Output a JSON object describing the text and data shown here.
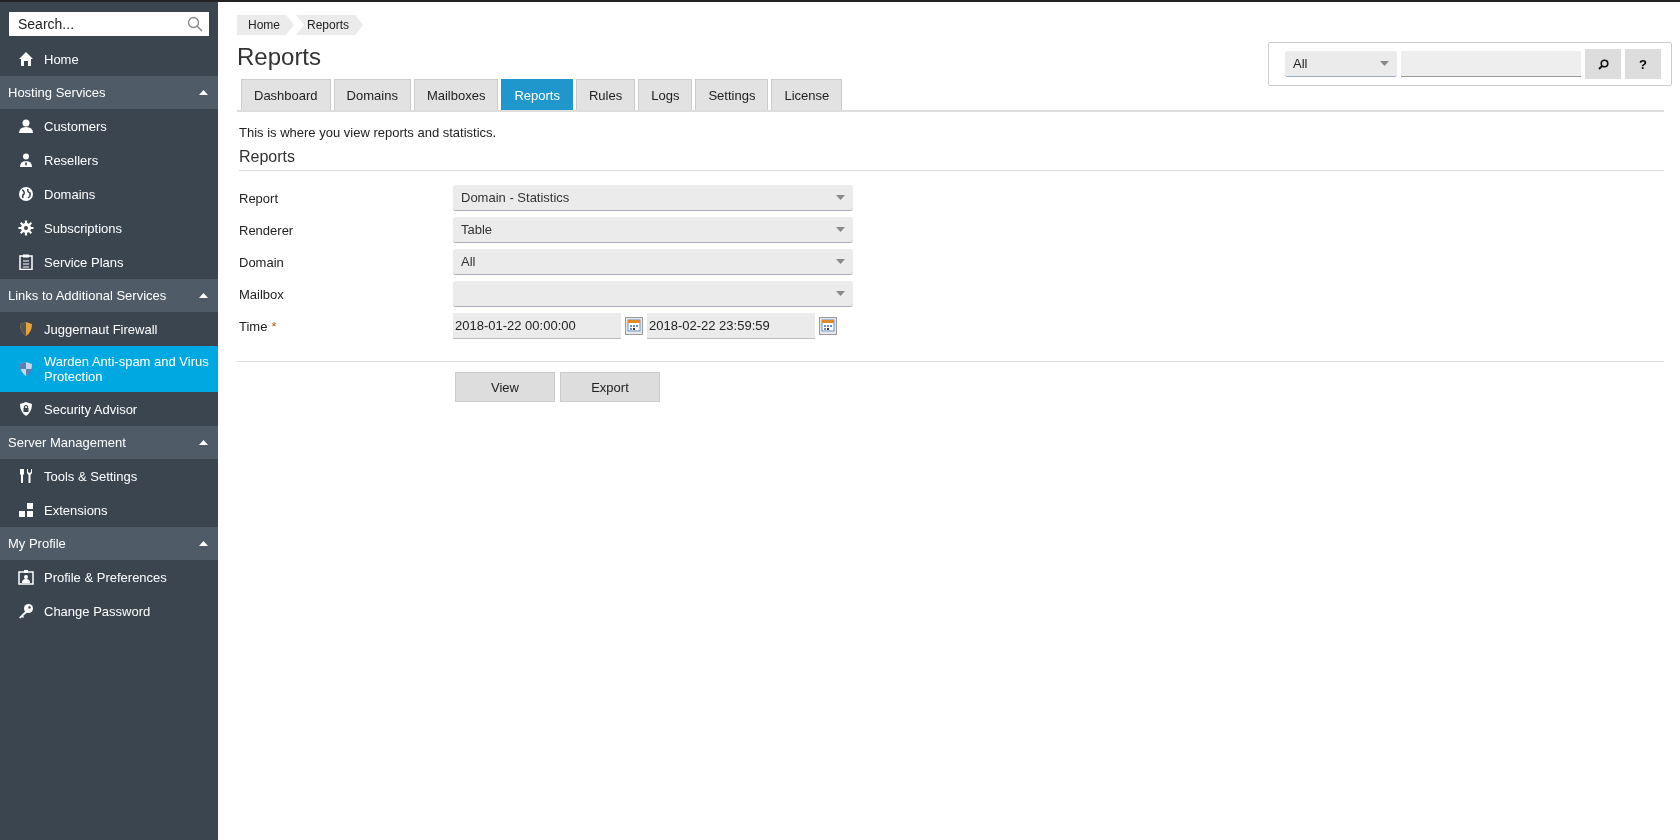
{
  "sidebar": {
    "search": {
      "placeholder": "Search..."
    },
    "top_items": [
      {
        "label": "Home",
        "kind": "home",
        "selected": false
      }
    ],
    "sections": [
      {
        "title": "Hosting Services",
        "expanded": true,
        "items": [
          {
            "label": "Customers",
            "kind": "person",
            "selected": false
          },
          {
            "label": "Resellers",
            "kind": "reseller",
            "selected": false
          },
          {
            "label": "Domains",
            "kind": "globe",
            "selected": false
          },
          {
            "label": "Subscriptions",
            "kind": "gear",
            "selected": false
          },
          {
            "label": "Service Plans",
            "kind": "clipboard",
            "selected": false
          }
        ]
      },
      {
        "title": "Links to Additional Services",
        "expanded": true,
        "items": [
          {
            "label": "Juggernaut Firewall",
            "kind": "shield-orange",
            "selected": false
          },
          {
            "label": "Warden Anti-spam and Virus Protection",
            "kind": "shield-blue",
            "selected": true
          },
          {
            "label": "Security Advisor",
            "kind": "shield-lock",
            "selected": false
          }
        ]
      },
      {
        "title": "Server Management",
        "expanded": true,
        "items": [
          {
            "label": "Tools & Settings",
            "kind": "tools",
            "selected": false
          },
          {
            "label": "Extensions",
            "kind": "blocks",
            "selected": false
          }
        ]
      },
      {
        "title": "My Profile",
        "expanded": true,
        "items": [
          {
            "label": "Profile & Preferences",
            "kind": "profile",
            "selected": false
          },
          {
            "label": "Change Password",
            "kind": "key",
            "selected": false
          }
        ]
      }
    ]
  },
  "breadcrumbs": [
    "Home",
    "Reports"
  ],
  "title": "Reports",
  "global_search": {
    "filter": "All",
    "help_button": "?"
  },
  "tabs": [
    {
      "label": "Dashboard",
      "selected": false
    },
    {
      "label": "Domains",
      "selected": false
    },
    {
      "label": "Mailboxes",
      "selected": false
    },
    {
      "label": "Reports",
      "selected": true
    },
    {
      "label": "Rules",
      "selected": false
    },
    {
      "label": "Logs",
      "selected": false
    },
    {
      "label": "Settings",
      "selected": false
    },
    {
      "label": "License",
      "selected": false
    }
  ],
  "description": "This is where you view reports and statistics.",
  "section_title": "Reports",
  "form": [
    {
      "kind": "select",
      "label": "Report",
      "value": "Domain - Statistics"
    },
    {
      "kind": "select",
      "label": "Renderer",
      "value": "Table"
    },
    {
      "kind": "select",
      "label": "Domain",
      "value": "All"
    },
    {
      "kind": "select",
      "label": "Mailbox"
    },
    {
      "kind": "daterange",
      "label": "Time",
      "required_mark": "*",
      "from": "2018-01-22 00:00:00",
      "to": "2018-02-22 23:59:59"
    }
  ],
  "buttons": [
    "View",
    "Export"
  ]
}
